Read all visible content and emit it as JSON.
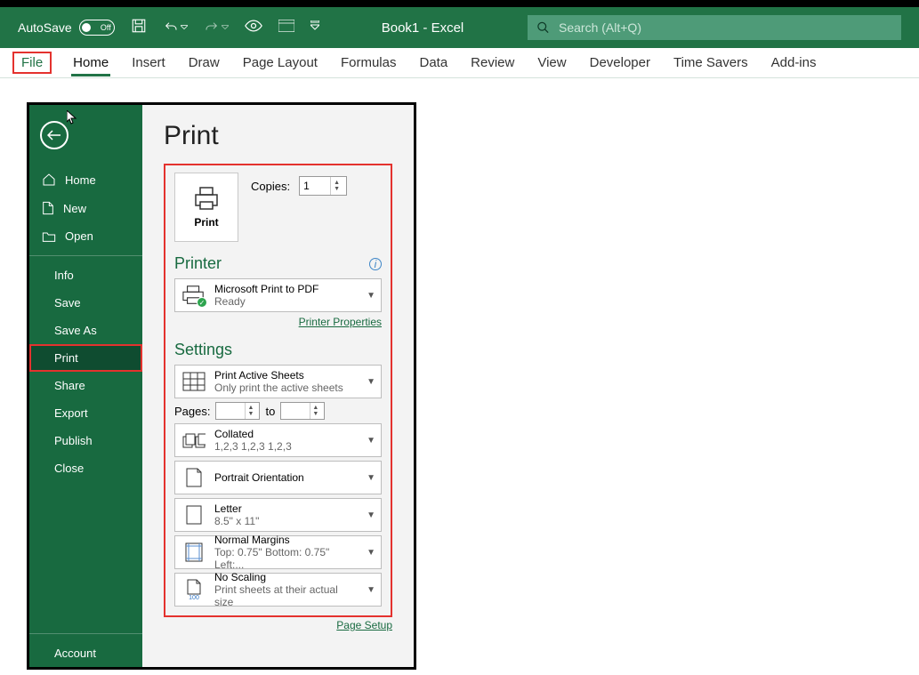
{
  "titlebar": {
    "autosave": "AutoSave",
    "autosave_state": "Off",
    "doc_title": "Book1 - Excel",
    "search_placeholder": "Search (Alt+Q)"
  },
  "ribbon": {
    "file": "File",
    "home": "Home",
    "insert": "Insert",
    "draw": "Draw",
    "page_layout": "Page Layout",
    "formulas": "Formulas",
    "data": "Data",
    "review": "Review",
    "view": "View",
    "developer": "Developer",
    "time_savers": "Time Savers",
    "addins": "Add-ins"
  },
  "side": {
    "home": "Home",
    "new": "New",
    "open": "Open",
    "info": "Info",
    "save": "Save",
    "save_as": "Save As",
    "print": "Print",
    "share": "Share",
    "export": "Export",
    "publish": "Publish",
    "close": "Close",
    "account": "Account"
  },
  "main": {
    "title": "Print",
    "print_btn": "Print",
    "copies_label": "Copies:",
    "copies_value": "1",
    "printer_head": "Printer",
    "printer": {
      "name": "Microsoft Print to PDF",
      "status": "Ready"
    },
    "printer_props": "Printer Properties",
    "settings_head": "Settings",
    "setting_sheets": {
      "title": "Print Active Sheets",
      "sub": "Only print the active sheets"
    },
    "pages_label": "Pages:",
    "pages_to": "to",
    "collated": {
      "title": "Collated",
      "sub": "1,2,3    1,2,3    1,2,3"
    },
    "orientation": {
      "title": "Portrait Orientation"
    },
    "paper": {
      "title": "Letter",
      "sub": "8.5\" x 11\""
    },
    "margins": {
      "title": "Normal Margins",
      "sub": "Top: 0.75\" Bottom: 0.75\" Left:..."
    },
    "scaling": {
      "title": "No Scaling",
      "sub": "Print sheets at their actual size",
      "badge": "100"
    },
    "page_setup": "Page Setup"
  }
}
